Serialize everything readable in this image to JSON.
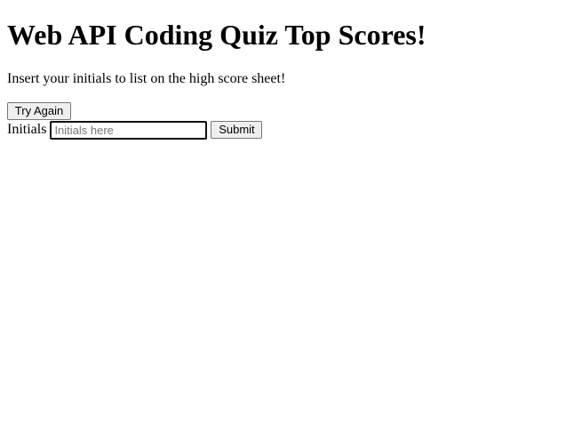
{
  "page": {
    "title": "Web API Coding Quiz Top Scores!",
    "instructions": "Insert your initials to list on the high score sheet!"
  },
  "controls": {
    "try_again_label": "Try Again",
    "initials_label": "Initials",
    "initials_value": "",
    "initials_placeholder": "Initials here",
    "submit_label": "Submit"
  }
}
